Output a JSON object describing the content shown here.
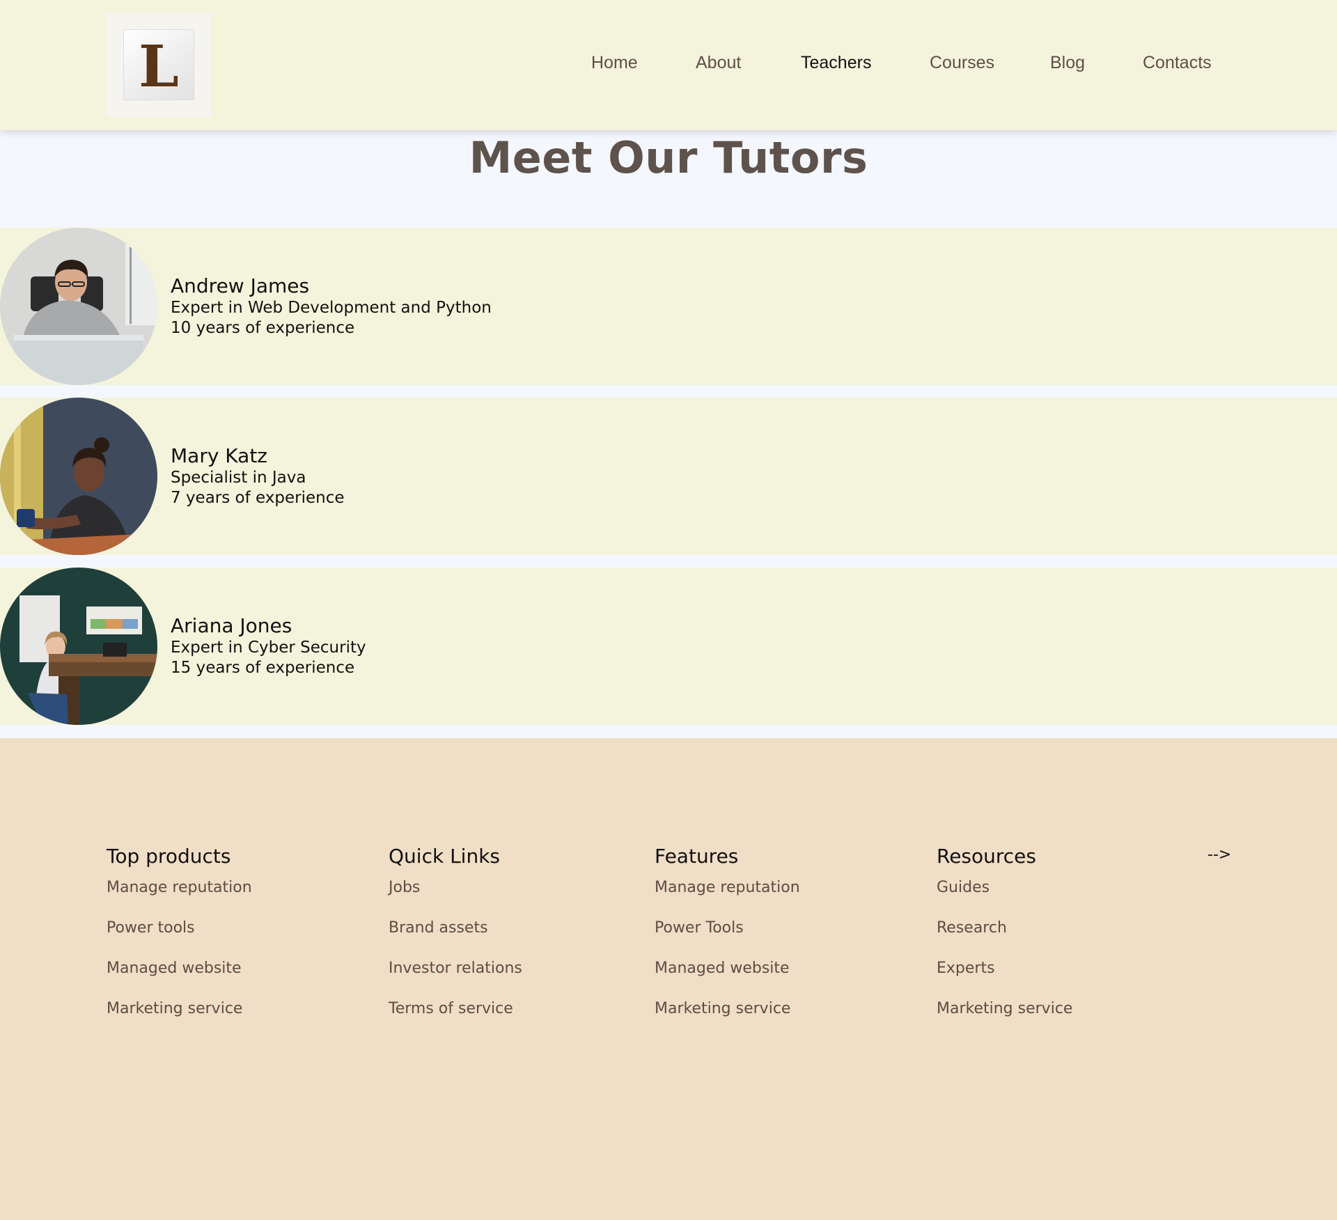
{
  "logo": {
    "letter": "L"
  },
  "nav": {
    "items": [
      {
        "label": "Home"
      },
      {
        "label": "About"
      },
      {
        "label": "Teachers"
      },
      {
        "label": "Courses"
      },
      {
        "label": "Blog"
      },
      {
        "label": "Contacts"
      }
    ],
    "active": "Teachers"
  },
  "main": {
    "title": "Meet Our Tutors",
    "tutors": [
      {
        "name": "Andrew James",
        "specialty": "Expert in Web Development and Python",
        "experience": "10 years of experience"
      },
      {
        "name": "Mary Katz",
        "specialty": "Specialist in Java",
        "experience": "7 years of experience"
      },
      {
        "name": "Ariana Jones",
        "specialty": "Expert in Cyber Security",
        "experience": "15 years of experience"
      }
    ]
  },
  "footer": {
    "columns": [
      {
        "heading": "Top products",
        "links": [
          "Manage reputation",
          "Power tools",
          "Managed website",
          "Marketing service"
        ]
      },
      {
        "heading": "Quick Links",
        "links": [
          "Jobs",
          "Brand assets",
          "Investor relations",
          "Terms of service"
        ]
      },
      {
        "heading": "Features",
        "links": [
          "Manage reputation",
          "Power Tools",
          "Managed website",
          "Marketing service"
        ]
      },
      {
        "heading": "Resources",
        "links": [
          "Guides",
          "Research",
          "Experts",
          "Marketing service"
        ]
      }
    ],
    "stray_text": "-->"
  },
  "colors": {
    "header_bg": "#f4f4dc",
    "page_bg": "#f4f7fd",
    "row_bg": "#f4f4dc",
    "footer_bg": "#f1dec6",
    "nav_text": "#5d4f45",
    "nav_active": "#111111",
    "title_text": "#5e534c",
    "logo_letter": "#5a3518"
  }
}
